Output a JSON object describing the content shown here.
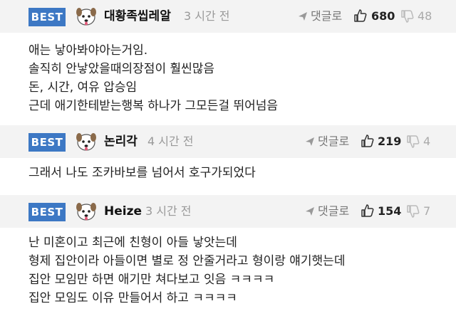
{
  "comments": [
    {
      "badge": "BEST",
      "author": "대황족씹레알",
      "time": "3 시간 전",
      "reply_label": "댓글로",
      "likes": "680",
      "dislikes": "48",
      "lines": [
        "애는 낳아봐야아는거임.",
        "솔직히 안낳았을때의장점이 훨씬많음",
        "돈, 시간, 여유 압승임",
        "근데 애기한테받는행복 하나가 그모든걸 뛰어넘음"
      ]
    },
    {
      "badge": "BEST",
      "author": "논리각",
      "time": "4 시간 전",
      "reply_label": "댓글로",
      "likes": "219",
      "dislikes": "4",
      "lines": [
        "그래서 나도 조카바보를 넘어서 호구가되었다"
      ]
    },
    {
      "badge": "BEST",
      "author": "Heize",
      "time": "3 시간 전",
      "reply_label": "댓글로",
      "likes": "154",
      "dislikes": "7",
      "lines": [
        "난 미혼이고 최근에 친형이 아들 낳앗는데",
        "형제 집안이라 아들이면 별로 정 안줄거라고 형이랑 얘기햇는데",
        "집안 모임만 하면 애기만 쳐다보고 잇음 ㅋㅋㅋㅋ",
        "집안 모임도 이유 만들어서 하고 ㅋㅋㅋㅋ"
      ]
    }
  ],
  "icons": {
    "reply": "reply-arrow-icon",
    "like": "thumbs-up-icon",
    "dislike": "thumbs-down-icon",
    "avatar": "dog-face-avatar-icon"
  },
  "colors": {
    "badge": "#3d78c4",
    "header_bg": "#f3f3f3"
  }
}
